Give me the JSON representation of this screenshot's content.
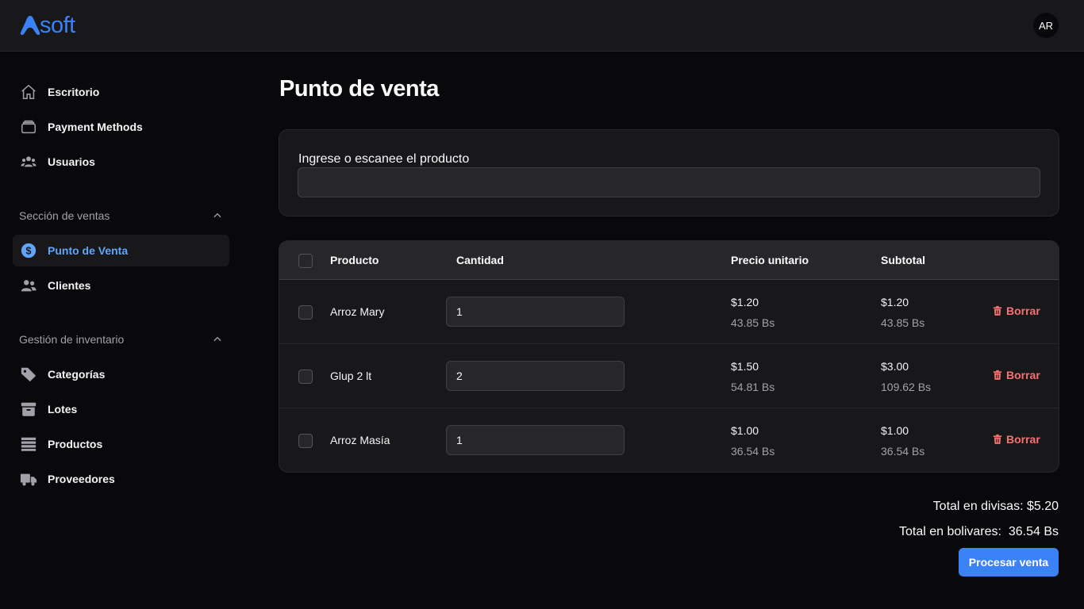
{
  "app": {
    "logo_text": "soft",
    "avatar_initials": "AR"
  },
  "sidebar": {
    "items": [
      {
        "label": "Escritorio",
        "icon": "home-icon"
      },
      {
        "label": "Payment Methods",
        "icon": "wallet-icon"
      },
      {
        "label": "Usuarios",
        "icon": "users-icon"
      }
    ],
    "sections": [
      {
        "title": "Sección de ventas",
        "items": [
          {
            "label": "Punto de Venta",
            "icon": "dollar-icon",
            "active": true
          },
          {
            "label": "Clientes",
            "icon": "clients-icon"
          }
        ]
      },
      {
        "title": "Gestión de inventario",
        "items": [
          {
            "label": "Categorías",
            "icon": "tag-icon"
          },
          {
            "label": "Lotes",
            "icon": "archive-icon"
          },
          {
            "label": "Productos",
            "icon": "list-icon"
          },
          {
            "label": "Proveedores",
            "icon": "truck-icon"
          }
        ]
      }
    ]
  },
  "main": {
    "title": "Punto de venta",
    "scan": {
      "label": "Ingrese o escanee el producto",
      "value": "",
      "placeholder": ""
    },
    "table": {
      "headers": [
        "Producto",
        "Cantidad",
        "Precio unitario",
        "Subtotal"
      ],
      "rows": [
        {
          "product": "Arroz Mary",
          "quantity": "1",
          "unit_usd": "$1.20",
          "unit_bs": "43.85 Bs",
          "subtotal_usd": "$1.20",
          "subtotal_bs": "43.85 Bs",
          "delete_label": "Borrar"
        },
        {
          "product": "Glup 2 lt",
          "quantity": "2",
          "unit_usd": "$1.50",
          "unit_bs": "54.81 Bs",
          "subtotal_usd": "$3.00",
          "subtotal_bs": "109.62 Bs",
          "delete_label": "Borrar"
        },
        {
          "product": "Arroz Masía",
          "quantity": "1",
          "unit_usd": "$1.00",
          "unit_bs": "36.54 Bs",
          "subtotal_usd": "$1.00",
          "subtotal_bs": "36.54 Bs",
          "delete_label": "Borrar"
        }
      ]
    },
    "totals": {
      "divisas": "Total en divisas: $5.20",
      "bolivares": "Total en bolivares:  36.54 Bs"
    },
    "process_button": "Procesar venta"
  },
  "colors": {
    "accent": "#3b82f6",
    "danger": "#f87171",
    "background": "#09090b",
    "surface": "#18181b"
  }
}
